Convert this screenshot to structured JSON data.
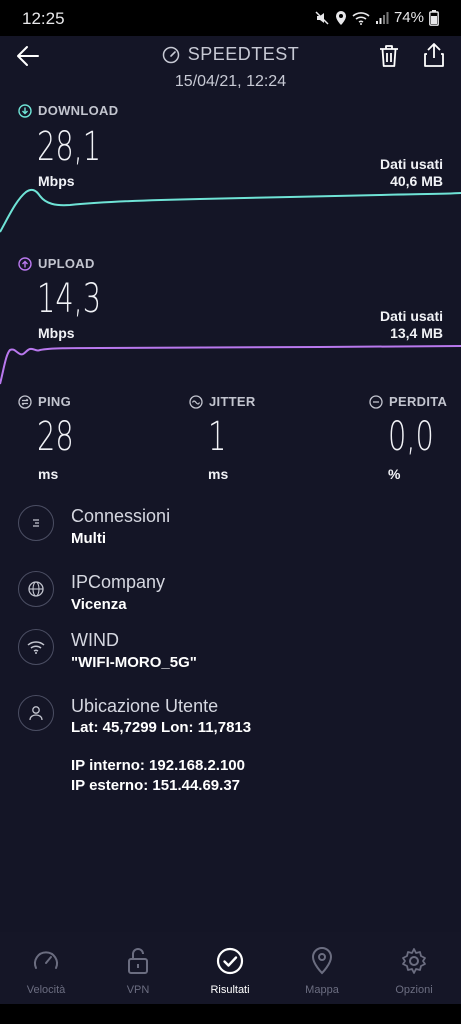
{
  "status_bar": {
    "time": "12:25",
    "battery": "74%"
  },
  "header": {
    "title": "SPEEDTEST",
    "datetime": "15/04/21, 12:24"
  },
  "download": {
    "label": "DOWNLOAD",
    "value": "28,1",
    "unit": "Mbps",
    "data_label": "Dati usati",
    "data_value": "40,6 MB",
    "color": "#6fe3d6"
  },
  "upload": {
    "label": "UPLOAD",
    "value": "14,3",
    "unit": "Mbps",
    "data_label": "Dati usati",
    "data_value": "13,4 MB",
    "color": "#b978ee"
  },
  "stats": {
    "ping": {
      "label": "PING",
      "value": "28",
      "unit": "ms"
    },
    "jitter": {
      "label": "JITTER",
      "value": "1",
      "unit": "ms"
    },
    "loss": {
      "label": "PERDITA",
      "value": "0,0",
      "unit": "%"
    }
  },
  "info": {
    "connections": {
      "title": "Connessioni",
      "value": "Multi"
    },
    "provider": {
      "title": "IPCompany",
      "value": "Vicenza"
    },
    "wifi": {
      "title": "WIND",
      "value": "\"WIFI-MORO_5G\""
    },
    "location": {
      "title": "Ubicazione Utente",
      "coords": "Lat: 45,7299 Lon: 11,7813",
      "internal_ip": "IP interno: 192.168.2.100",
      "external_ip": "IP esterno: 151.44.69.37"
    }
  },
  "nav": {
    "items": [
      {
        "label": "Velocità",
        "icon": "speedometer-icon"
      },
      {
        "label": "VPN",
        "icon": "lock-icon"
      },
      {
        "label": "Risultati",
        "icon": "check-circle-icon",
        "active": true
      },
      {
        "label": "Mappa",
        "icon": "map-pin-icon"
      },
      {
        "label": "Opzioni",
        "icon": "gear-icon"
      }
    ]
  }
}
